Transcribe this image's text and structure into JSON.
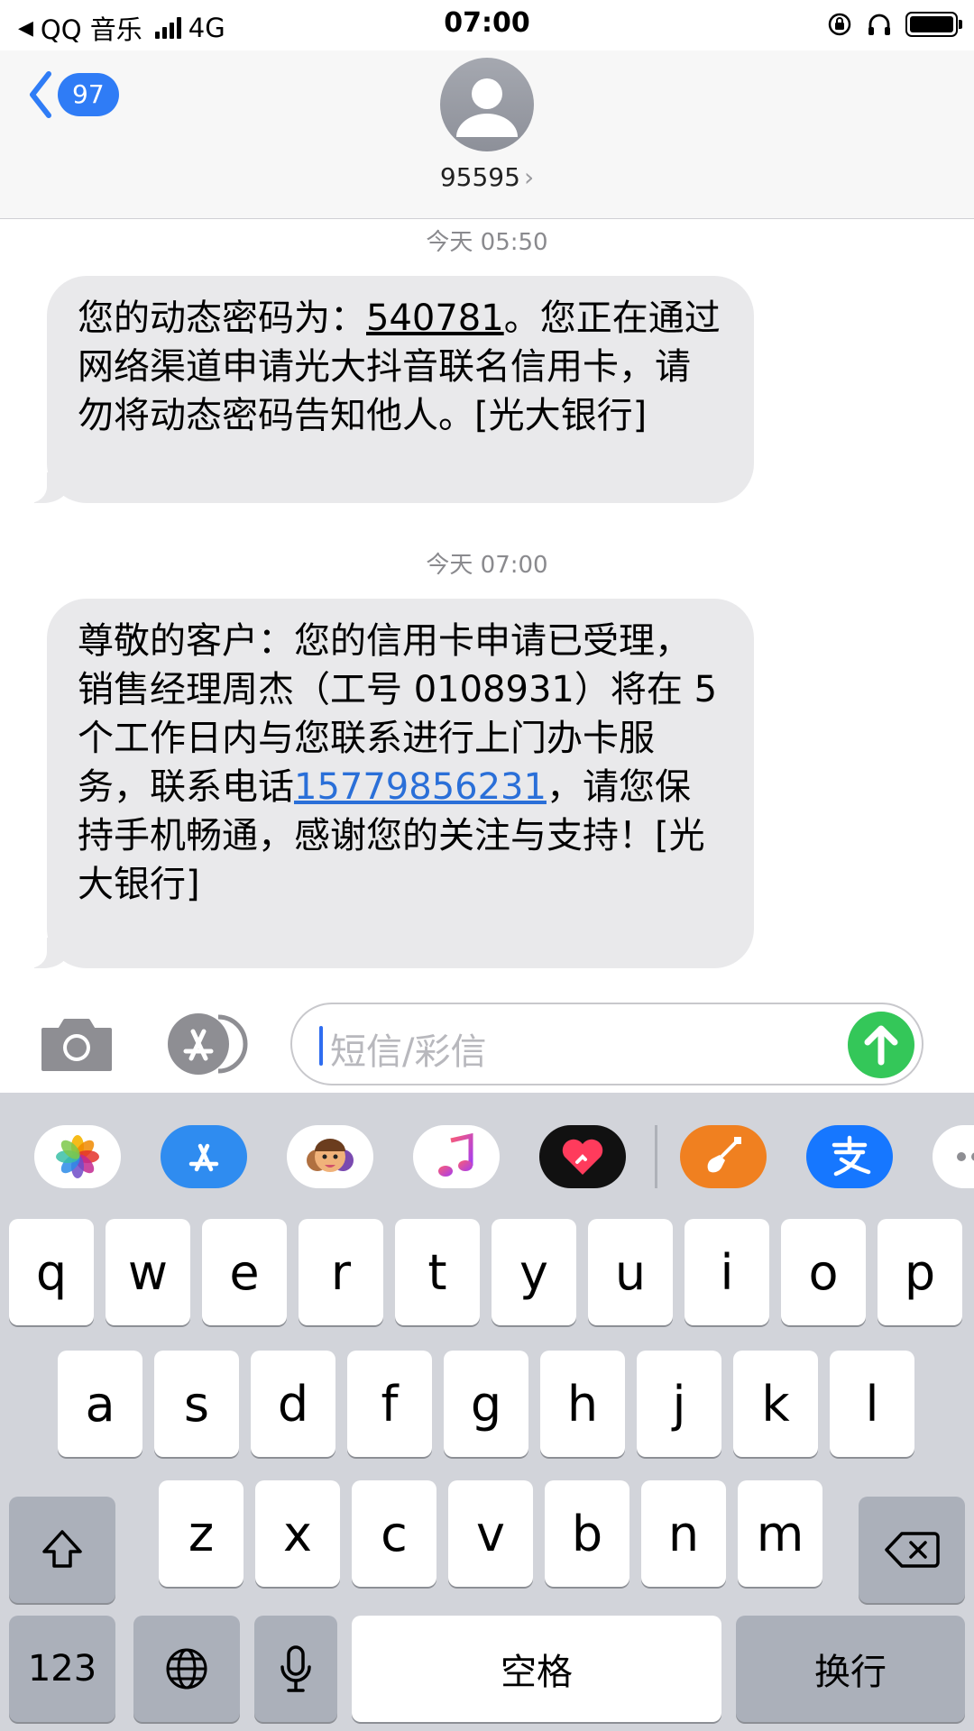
{
  "status_bar": {
    "carrier": "QQ 音乐",
    "network": "4G",
    "time": "07:00"
  },
  "header": {
    "back_badge": "97",
    "contact_name": "95595",
    "chevron": "›"
  },
  "messages": [
    {
      "timestamp": "今天 05:50",
      "text_before": "您的动态密码为：",
      "code": "540781",
      "text_after": "。您正在通过网络渠道申请光大抖音联名信用卡，请勿将动态密码告知他人。[光大银行]"
    },
    {
      "timestamp": "今天 07:00",
      "text_before": "尊敬的客户：您的信用卡申请已受理，销售经理周杰（工号 0108931）将在 5 个工作日内与您联系进行上门办卡服务，联系电话",
      "phone": "15779856231",
      "text_after": "，请您保持手机畅通，感谢您的关注与支持！[光大银行]"
    }
  ],
  "input": {
    "placeholder": "短信/彩信"
  },
  "app_drawer": {
    "apps": [
      "photos-icon",
      "app-store-icon",
      "memoji-icon",
      "music-icon",
      "digital-touch-icon",
      "garageband-icon",
      "alipay-icon",
      "more-apps-icon"
    ]
  },
  "keyboard": {
    "row1": [
      "q",
      "w",
      "e",
      "r",
      "t",
      "y",
      "u",
      "i",
      "o",
      "p"
    ],
    "row2": [
      "a",
      "s",
      "d",
      "f",
      "g",
      "h",
      "j",
      "k",
      "l"
    ],
    "row3": [
      "z",
      "x",
      "c",
      "v",
      "b",
      "n",
      "m"
    ],
    "numbers_key": "123",
    "space_key": "空格",
    "return_key": "换行"
  },
  "colors": {
    "accent_blue": "#2f7cf6",
    "send_green": "#34c759",
    "bubble_gray": "#e9e9eb",
    "link_blue": "#2a6fd8"
  }
}
